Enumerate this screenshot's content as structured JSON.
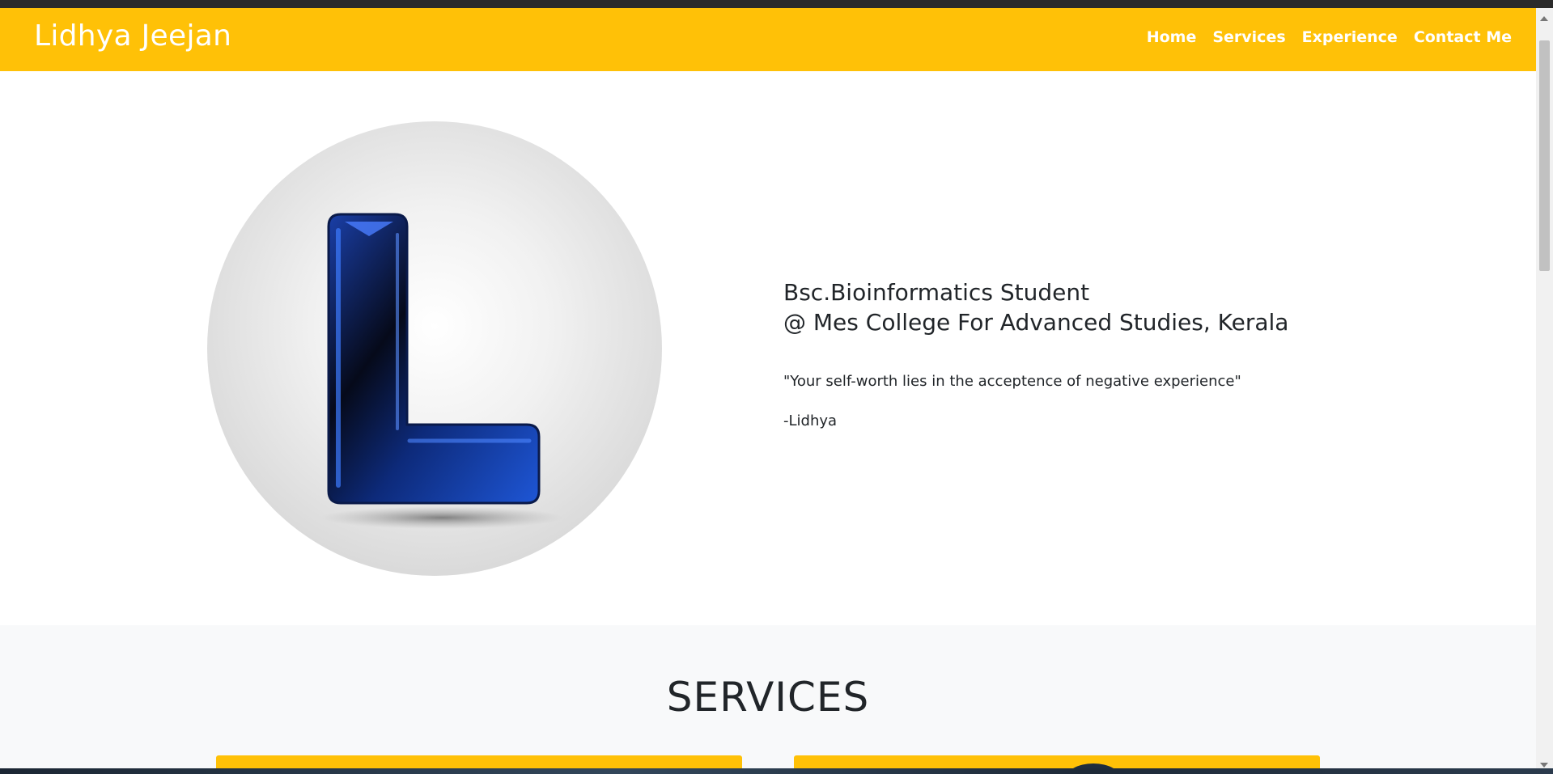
{
  "site": {
    "brand": "Lidhya Jeejan",
    "nav": [
      "Home",
      "Services",
      "Experience",
      "Contact Me"
    ],
    "accent": "#ffc107"
  },
  "hero": {
    "role_line1": "Bsc.Bioinformatics Student",
    "role_line2": "@ Mes College For Advanced Studies, Kerala",
    "quote": "\"Your self-worth lies in the acceptence of negative experience\"",
    "author": "-Lidhya",
    "profile_icon": "letter-l-logo"
  },
  "services": {
    "title": "SERVICES"
  }
}
